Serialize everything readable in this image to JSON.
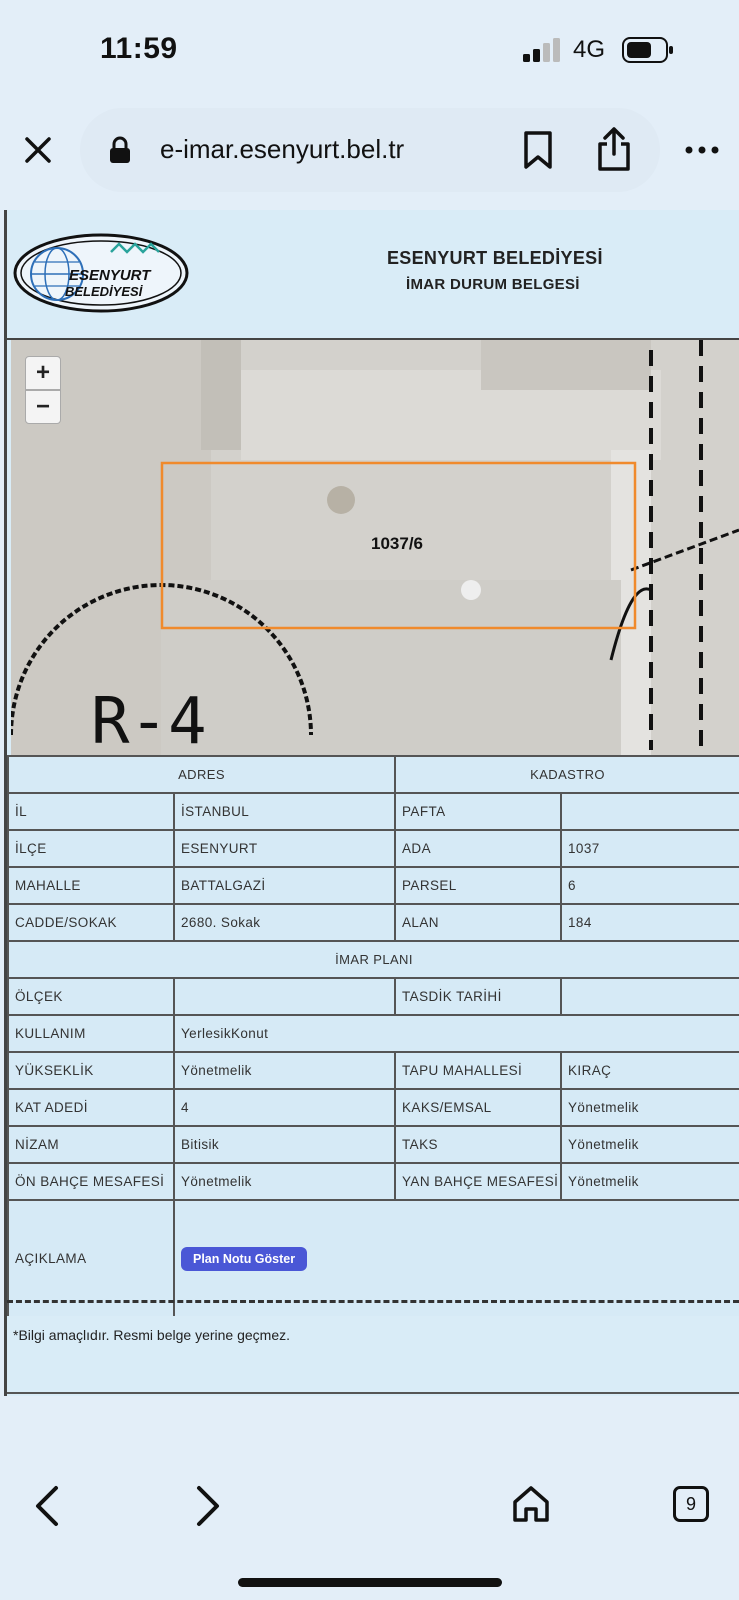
{
  "status": {
    "time": "11:59",
    "network": "4G"
  },
  "browser": {
    "url": "e-imar.esenyurt.bel.tr",
    "tab_count": "9"
  },
  "header": {
    "logo_text_1": "ESENYURT",
    "logo_text_2": "BELEDİYESİ",
    "title": "ESENYURT BELEDİYESİ",
    "subtitle": "İMAR DURUM BELGESİ"
  },
  "map": {
    "zoom_in": "+",
    "zoom_out": "−",
    "parcel_label": "1037/6",
    "zone_label": "R-4"
  },
  "table": {
    "adres_header": "ADRES",
    "kadastro_header": "KADASTRO",
    "imar_header": "İMAR PLANI",
    "rows_top": [
      {
        "l1": "İL",
        "v1": "İSTANBUL",
        "l2": "PAFTA",
        "v2": ""
      },
      {
        "l1": "İLÇE",
        "v1": "ESENYURT",
        "l2": "ADA",
        "v2": "1037"
      },
      {
        "l1": "MAHALLE",
        "v1": "BATTALGAZİ",
        "l2": "PARSEL",
        "v2": "6"
      },
      {
        "l1": "CADDE/SOKAK",
        "v1": "2680. Sokak",
        "l2": "ALAN",
        "v2": "184"
      }
    ],
    "olcek": {
      "label": "ÖLÇEK",
      "value": "",
      "label2": "TASDİK TARİHİ",
      "value2": ""
    },
    "kullanim": {
      "label": "KULLANIM",
      "value": "YerlesikKonut"
    },
    "rows_bottom": [
      {
        "l1": "YÜKSEKLİK",
        "v1": "Yönetmelik",
        "l2": "TAPU MAHALLESİ",
        "v2": "KIRAÇ"
      },
      {
        "l1": "KAT ADEDİ",
        "v1": "4",
        "l2": "KAKS/EMSAL",
        "v2": "Yönetmelik"
      },
      {
        "l1": "NİZAM",
        "v1": "Bitisik",
        "l2": "TAKS",
        "v2": "Yönetmelik"
      },
      {
        "l1": "ÖN BAHÇE MESAFESİ",
        "v1": "Yönetmelik",
        "l2": "YAN BAHÇE MESAFESİ",
        "v2": "Yönetmelik"
      }
    ],
    "aciklama": {
      "label": "AÇIKLAMA",
      "button": "Plan Notu Göster"
    }
  },
  "note": "*Bilgi amaçlıdır. Resmi belge yerine geçmez.",
  "colors": {
    "page_bg": "#d9ecf7",
    "button": "#4a57d6",
    "parcel_outline": "#f08a2c"
  }
}
